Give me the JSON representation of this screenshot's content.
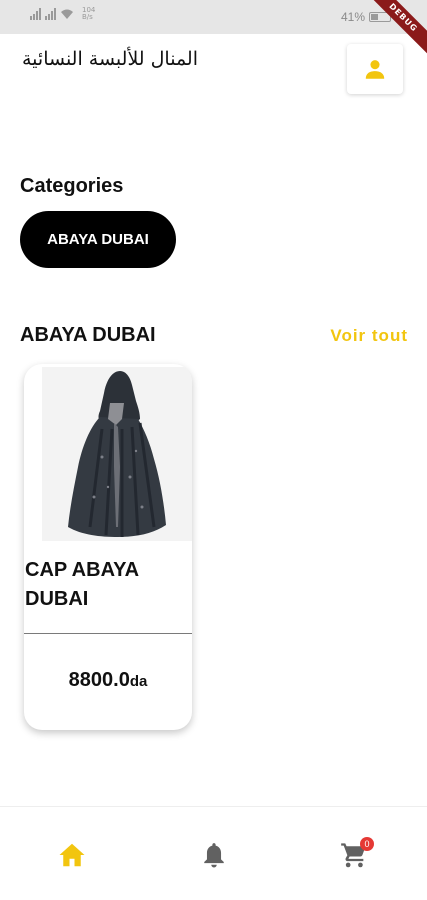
{
  "status_bar": {
    "net_speed_value": "104",
    "net_speed_unit": "B/s",
    "battery_percent": "41%",
    "battery_level": 0.41,
    "debug_label": "DEBUG"
  },
  "header": {
    "title": "المنال للألبسة النسائية",
    "account_icon": "person-icon",
    "accent_color": "#f2c50f"
  },
  "categories": {
    "heading": "Categories",
    "items": [
      {
        "label": "ABAYA DUBAI"
      }
    ]
  },
  "products_section": {
    "heading": "ABAYA DUBAI",
    "see_all": "Voir tout",
    "products": [
      {
        "name": "CAP ABAYA DUBAI",
        "price": "8800.0",
        "currency": "da",
        "image_icon": "abaya-image"
      }
    ]
  },
  "bottom_nav": {
    "items": [
      {
        "icon": "home-icon",
        "active": true
      },
      {
        "icon": "bell-icon",
        "active": false
      },
      {
        "icon": "cart-icon",
        "active": false
      }
    ],
    "cart_badge": "0",
    "active_color": "#f2c50f",
    "inactive_color": "#616161"
  }
}
